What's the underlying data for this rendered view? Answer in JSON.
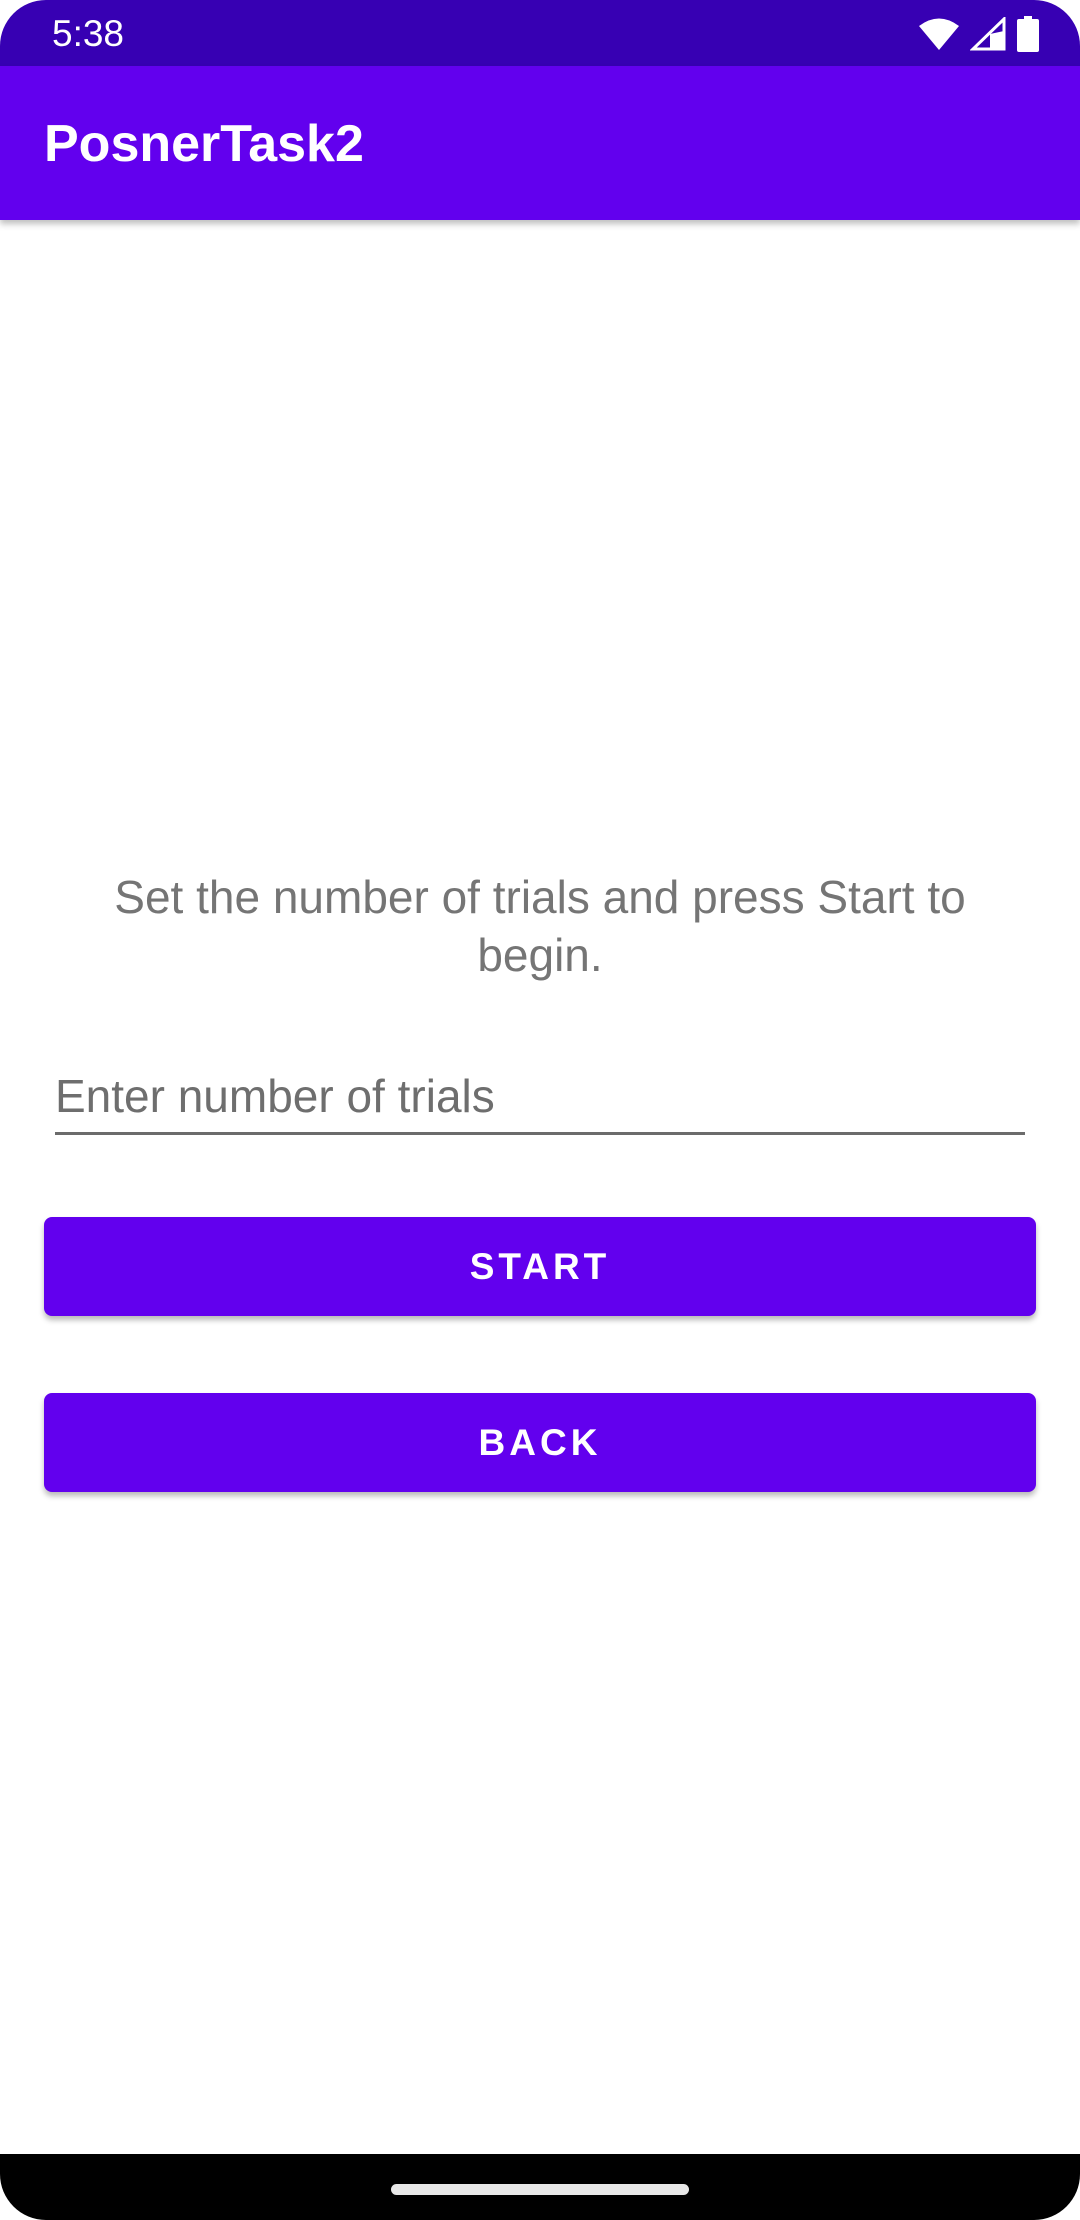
{
  "status_bar": {
    "time": "5:38",
    "icons": [
      "wifi-icon",
      "signal-icon",
      "battery-icon"
    ]
  },
  "app_bar": {
    "title": "PosnerTask2"
  },
  "main": {
    "instructions": "Set the number of trials and press Start to begin.",
    "trials_input": {
      "placeholder": "Enter number of trials",
      "value": ""
    },
    "start_label": "START",
    "back_label": "BACK"
  },
  "colors": {
    "status_bar": "#3700b3",
    "primary": "#6200ee",
    "text_secondary": "#757575",
    "background": "#ffffff"
  }
}
